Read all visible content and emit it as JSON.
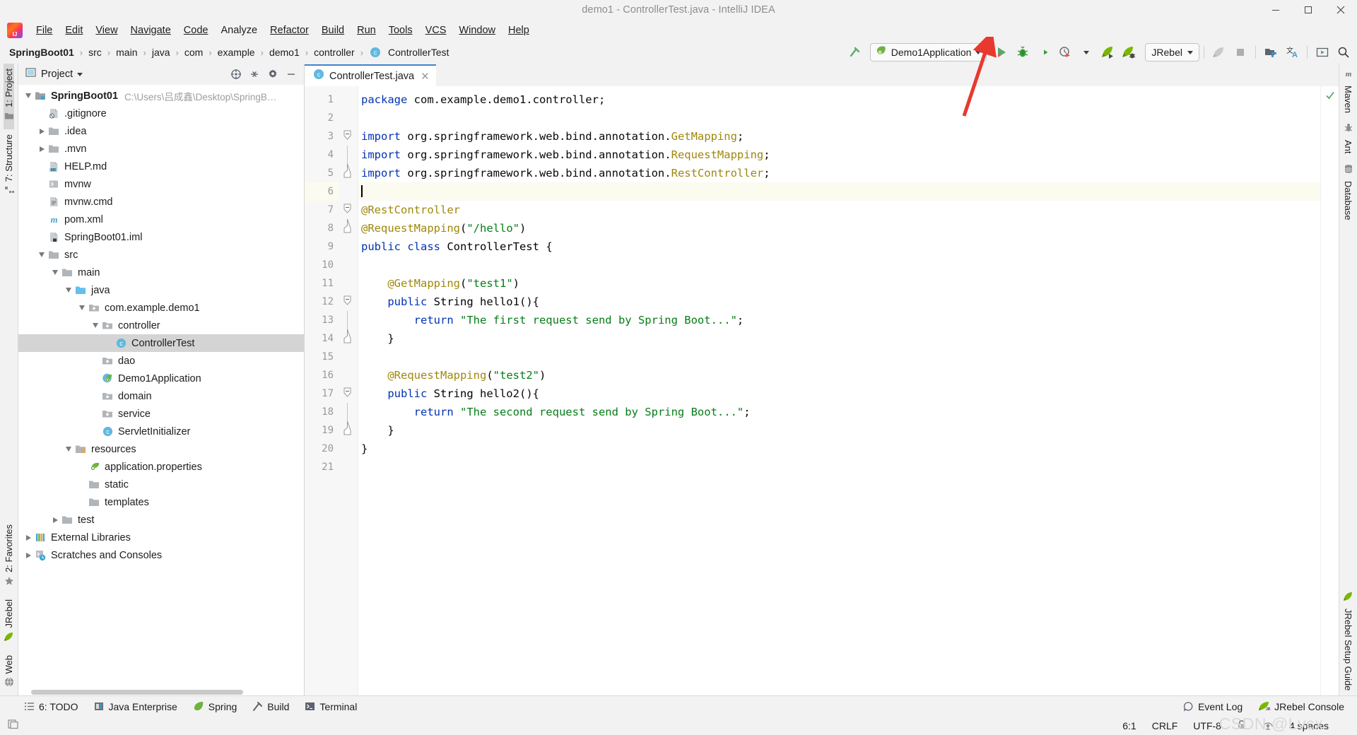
{
  "window": {
    "title": "demo1 - ControllerTest.java - IntelliJ IDEA",
    "minimize": "—",
    "maximize": "❐",
    "close": "✕"
  },
  "menubar": {
    "items": [
      "File",
      "Edit",
      "View",
      "Navigate",
      "Code",
      "Analyze",
      "Refactor",
      "Build",
      "Run",
      "Tools",
      "VCS",
      "Window",
      "Help"
    ]
  },
  "breadcrumb": {
    "items": [
      "SpringBoot01",
      "src",
      "main",
      "java",
      "com",
      "example",
      "demo1",
      "controller",
      "ControllerTest"
    ],
    "separator": "›"
  },
  "run_toolbar": {
    "config_name": "Demo1Application",
    "config_icon": "spring-boot-icon",
    "dropdown_caret": "▾",
    "buttons": [
      {
        "name": "run-button",
        "icon": "play-icon",
        "color": "#59a869"
      },
      {
        "name": "debug-button",
        "icon": "bug-icon",
        "color": "#3b9d3b"
      },
      {
        "name": "run-with-coverage-button",
        "icon": "coverage-icon",
        "color": "#4a4a4a"
      },
      {
        "name": "profiler-button",
        "icon": "profiler-icon",
        "color": "#6e6e6e"
      },
      {
        "name": "jrebel-run-button",
        "icon": "jrebel-rocket-icon",
        "color": "#7ab800"
      },
      {
        "name": "jrebel-debug-button",
        "icon": "jrebel-debug-icon",
        "color": "#7ab800"
      }
    ],
    "jrebel_label": "JRebel",
    "right_buttons": [
      {
        "name": "jrebel-stop-icon",
        "label": ""
      },
      {
        "name": "stop-button",
        "label": ""
      },
      {
        "name": "project-structure-icon",
        "label": ""
      },
      {
        "name": "translate-icon",
        "label": ""
      },
      {
        "name": "presentation-icon",
        "label": ""
      },
      {
        "name": "search-everywhere-icon",
        "label": ""
      }
    ],
    "update_icon": "hammer-icon"
  },
  "left_stripe": {
    "top": [
      {
        "label": "1: Project",
        "icon": "project-folder-icon",
        "active": true
      },
      {
        "label": "7: Structure",
        "icon": "structure-icon",
        "active": false
      }
    ],
    "bottom": [
      {
        "label": "2: Favorites",
        "icon": "star-icon",
        "active": false
      },
      {
        "label": "JRebel",
        "icon": "jrebel-rocket-icon",
        "active": false
      },
      {
        "label": "Web",
        "icon": "web-globe-icon",
        "active": false
      }
    ]
  },
  "right_stripe": {
    "top": [
      {
        "label": "Maven",
        "icon": "maven-m-icon"
      },
      {
        "label": "Ant",
        "icon": "ant-icon"
      },
      {
        "label": "Database",
        "icon": "database-icon"
      }
    ],
    "bottom": [
      {
        "label": "JRebel Setup Guide",
        "icon": "jrebel-rocket-icon"
      }
    ]
  },
  "project_panel": {
    "title": "Project",
    "title_caret": "▾",
    "actions": [
      {
        "name": "select-opened-file-icon"
      },
      {
        "name": "collapse-all-icon"
      },
      {
        "name": "settings-gear-icon"
      },
      {
        "name": "hide-panel-icon"
      }
    ],
    "tree": [
      {
        "depth": 0,
        "twist": "open",
        "icon": "module-folder-icon",
        "label": "SpringBoot01",
        "bold": true,
        "path": "C:\\Users\\吕成鑫\\Desktop\\SpringB…",
        "selected": false
      },
      {
        "depth": 1,
        "twist": "none",
        "icon": "gitignore-file-icon",
        "label": ".gitignore",
        "bold": false,
        "path": "",
        "selected": false
      },
      {
        "depth": 1,
        "twist": "closed",
        "icon": "folder-icon",
        "label": ".idea",
        "bold": false,
        "path": "",
        "selected": false
      },
      {
        "depth": 1,
        "twist": "closed",
        "icon": "folder-icon",
        "label": ".mvn",
        "bold": false,
        "path": "",
        "selected": false
      },
      {
        "depth": 1,
        "twist": "none",
        "icon": "markdown-file-icon",
        "label": "HELP.md",
        "bold": false,
        "path": "",
        "selected": false
      },
      {
        "depth": 1,
        "twist": "none",
        "icon": "shell-script-icon",
        "label": "mvnw",
        "bold": false,
        "path": "",
        "selected": false
      },
      {
        "depth": 1,
        "twist": "none",
        "icon": "cmd-file-icon",
        "label": "mvnw.cmd",
        "bold": false,
        "path": "",
        "selected": false
      },
      {
        "depth": 1,
        "twist": "none",
        "icon": "maven-pom-icon",
        "label": "pom.xml",
        "bold": false,
        "path": "",
        "selected": false
      },
      {
        "depth": 1,
        "twist": "none",
        "icon": "iml-file-icon",
        "label": "SpringBoot01.iml",
        "bold": false,
        "path": "",
        "selected": false
      },
      {
        "depth": 1,
        "twist": "open",
        "icon": "folder-icon",
        "label": "src",
        "bold": false,
        "path": "",
        "selected": false
      },
      {
        "depth": 2,
        "twist": "open",
        "icon": "folder-icon",
        "label": "main",
        "bold": false,
        "path": "",
        "selected": false
      },
      {
        "depth": 3,
        "twist": "open",
        "icon": "source-folder-icon",
        "label": "java",
        "bold": false,
        "path": "",
        "selected": false
      },
      {
        "depth": 4,
        "twist": "open",
        "icon": "package-icon",
        "label": "com.example.demo1",
        "bold": false,
        "path": "",
        "selected": false
      },
      {
        "depth": 5,
        "twist": "open",
        "icon": "package-icon",
        "label": "controller",
        "bold": false,
        "path": "",
        "selected": false
      },
      {
        "depth": 6,
        "twist": "none",
        "icon": "java-class-icon",
        "label": "ControllerTest",
        "bold": false,
        "path": "",
        "selected": true
      },
      {
        "depth": 5,
        "twist": "none",
        "icon": "package-icon",
        "label": "dao",
        "bold": false,
        "path": "",
        "selected": false
      },
      {
        "depth": 5,
        "twist": "none",
        "icon": "spring-boot-class-icon",
        "label": "Demo1Application",
        "bold": false,
        "path": "",
        "selected": false
      },
      {
        "depth": 5,
        "twist": "none",
        "icon": "package-icon",
        "label": "domain",
        "bold": false,
        "path": "",
        "selected": false
      },
      {
        "depth": 5,
        "twist": "none",
        "icon": "package-icon",
        "label": "service",
        "bold": false,
        "path": "",
        "selected": false
      },
      {
        "depth": 5,
        "twist": "none",
        "icon": "java-class-icon",
        "label": "ServletInitializer",
        "bold": false,
        "path": "",
        "selected": false
      },
      {
        "depth": 3,
        "twist": "open",
        "icon": "resource-folder-icon",
        "label": "resources",
        "bold": false,
        "path": "",
        "selected": false
      },
      {
        "depth": 4,
        "twist": "none",
        "icon": "spring-properties-icon",
        "label": "application.properties",
        "bold": false,
        "path": "",
        "selected": false
      },
      {
        "depth": 4,
        "twist": "none",
        "icon": "folder-icon",
        "label": "static",
        "bold": false,
        "path": "",
        "selected": false
      },
      {
        "depth": 4,
        "twist": "none",
        "icon": "folder-icon",
        "label": "templates",
        "bold": false,
        "path": "",
        "selected": false
      },
      {
        "depth": 2,
        "twist": "closed",
        "icon": "folder-icon",
        "label": "test",
        "bold": false,
        "path": "",
        "selected": false
      },
      {
        "depth": 0,
        "twist": "closed",
        "icon": "libraries-icon",
        "label": "External Libraries",
        "bold": false,
        "path": "",
        "selected": false
      },
      {
        "depth": 0,
        "twist": "closed",
        "icon": "scratches-icon",
        "label": "Scratches and Consoles",
        "bold": false,
        "path": "",
        "selected": false
      }
    ]
  },
  "editor": {
    "tab": {
      "label": "ControllerTest.java",
      "icon": "java-class-icon",
      "close": "✕"
    },
    "cursor_line": 6,
    "lines": [
      {
        "n": 1,
        "fold": "none",
        "gutter_mark": "none",
        "tokens": [
          {
            "t": "package ",
            "c": "kw"
          },
          {
            "t": "com.example.demo1.controller;",
            "c": "plain"
          }
        ]
      },
      {
        "n": 2,
        "fold": "none",
        "gutter_mark": "none",
        "tokens": []
      },
      {
        "n": 3,
        "fold": "start",
        "gutter_mark": "none",
        "tokens": [
          {
            "t": "import ",
            "c": "kw"
          },
          {
            "t": "org.springframework.web.bind.annotation.",
            "c": "plain"
          },
          {
            "t": "GetMapping",
            "c": "ann"
          },
          {
            "t": ";",
            "c": "plain"
          }
        ]
      },
      {
        "n": 4,
        "fold": "mid",
        "gutter_mark": "none",
        "tokens": [
          {
            "t": "import ",
            "c": "kw"
          },
          {
            "t": "org.springframework.web.bind.annotation.",
            "c": "plain"
          },
          {
            "t": "RequestMapping",
            "c": "ann"
          },
          {
            "t": ";",
            "c": "plain"
          }
        ]
      },
      {
        "n": 5,
        "fold": "end",
        "gutter_mark": "none",
        "tokens": [
          {
            "t": "import ",
            "c": "kw"
          },
          {
            "t": "org.springframework.web.bind.annotation.",
            "c": "plain"
          },
          {
            "t": "RestController",
            "c": "ann"
          },
          {
            "t": ";",
            "c": "plain"
          }
        ]
      },
      {
        "n": 6,
        "fold": "none",
        "gutter_mark": "none",
        "caret": true,
        "tokens": []
      },
      {
        "n": 7,
        "fold": "start",
        "gutter_mark": "none",
        "tokens": [
          {
            "t": "@RestController",
            "c": "ann"
          }
        ]
      },
      {
        "n": 8,
        "fold": "end",
        "gutter_mark": "none",
        "tokens": [
          {
            "t": "@RequestMapping",
            "c": "ann"
          },
          {
            "t": "(",
            "c": "plain"
          },
          {
            "t": "\"/hello\"",
            "c": "str"
          },
          {
            "t": ")",
            "c": "plain"
          }
        ]
      },
      {
        "n": 9,
        "fold": "none",
        "gutter_mark": "spring-bean",
        "tokens": [
          {
            "t": "public ",
            "c": "kw"
          },
          {
            "t": "class ",
            "c": "kw"
          },
          {
            "t": "ControllerTest ",
            "c": "cls"
          },
          {
            "t": "{",
            "c": "plain"
          }
        ]
      },
      {
        "n": 10,
        "fold": "none",
        "gutter_mark": "none",
        "tokens": []
      },
      {
        "n": 11,
        "fold": "none",
        "gutter_mark": "none",
        "tokens": [
          {
            "t": "    ",
            "c": "plain"
          },
          {
            "t": "@GetMapping",
            "c": "ann"
          },
          {
            "t": "(",
            "c": "plain"
          },
          {
            "t": "\"test1\"",
            "c": "str"
          },
          {
            "t": ")",
            "c": "plain"
          }
        ]
      },
      {
        "n": 12,
        "fold": "start",
        "gutter_mark": "spring-bean",
        "tokens": [
          {
            "t": "    ",
            "c": "plain"
          },
          {
            "t": "public ",
            "c": "kw"
          },
          {
            "t": "String ",
            "c": "cls"
          },
          {
            "t": "hello1",
            "c": "plain"
          },
          {
            "t": "(){",
            "c": "plain"
          }
        ]
      },
      {
        "n": 13,
        "fold": "mid",
        "gutter_mark": "none",
        "tokens": [
          {
            "t": "        ",
            "c": "plain"
          },
          {
            "t": "return ",
            "c": "kw"
          },
          {
            "t": "\"The first request send by Spring Boot...\"",
            "c": "str"
          },
          {
            "t": ";",
            "c": "plain"
          }
        ]
      },
      {
        "n": 14,
        "fold": "end",
        "gutter_mark": "none",
        "tokens": [
          {
            "t": "    }",
            "c": "plain"
          }
        ]
      },
      {
        "n": 15,
        "fold": "none",
        "gutter_mark": "none",
        "tokens": []
      },
      {
        "n": 16,
        "fold": "none",
        "gutter_mark": "none",
        "tokens": [
          {
            "t": "    ",
            "c": "plain"
          },
          {
            "t": "@RequestMapping",
            "c": "ann"
          },
          {
            "t": "(",
            "c": "plain"
          },
          {
            "t": "\"test2\"",
            "c": "str"
          },
          {
            "t": ")",
            "c": "plain"
          }
        ]
      },
      {
        "n": 17,
        "fold": "start",
        "gutter_mark": "spring-bean",
        "tokens": [
          {
            "t": "    ",
            "c": "plain"
          },
          {
            "t": "public ",
            "c": "kw"
          },
          {
            "t": "String ",
            "c": "cls"
          },
          {
            "t": "hello2",
            "c": "plain"
          },
          {
            "t": "(){",
            "c": "plain"
          }
        ]
      },
      {
        "n": 18,
        "fold": "mid",
        "gutter_mark": "none",
        "tokens": [
          {
            "t": "        ",
            "c": "plain"
          },
          {
            "t": "return ",
            "c": "kw"
          },
          {
            "t": "\"The second request send by Spring Boot...\"",
            "c": "str"
          },
          {
            "t": ";",
            "c": "plain"
          }
        ]
      },
      {
        "n": 19,
        "fold": "end",
        "gutter_mark": "none",
        "tokens": [
          {
            "t": "    }",
            "c": "plain"
          }
        ]
      },
      {
        "n": 20,
        "fold": "none",
        "gutter_mark": "none",
        "tokens": [
          {
            "t": "}",
            "c": "plain"
          }
        ]
      },
      {
        "n": 21,
        "fold": "none",
        "gutter_mark": "none",
        "tokens": []
      }
    ],
    "inspection_status": "ok-check"
  },
  "tool_window_bar": {
    "items": [
      {
        "label": "6: TODO",
        "underline": "6",
        "icon": "todo-list-icon"
      },
      {
        "label": "Java Enterprise",
        "underline": "",
        "icon": "java-enterprise-icon"
      },
      {
        "label": "Spring",
        "underline": "",
        "icon": "spring-leaf-icon"
      },
      {
        "label": "Build",
        "underline": "",
        "icon": "hammer-icon"
      },
      {
        "label": "Terminal",
        "underline": "",
        "icon": "terminal-icon"
      }
    ],
    "right_items": [
      {
        "label": "Event Log",
        "icon": "event-log-icon"
      },
      {
        "label": "JRebel Console",
        "icon": "jrebel-rocket-icon"
      }
    ]
  },
  "status_bar": {
    "left_icon": "memory-indicator-icon",
    "position": "6:1",
    "line_separator": "CRLF",
    "encoding": "UTF-8",
    "lock_icon": "unlocked-icon",
    "inspection_icon": "inspection-eye-icon",
    "indent": "4 spaces"
  },
  "watermark": "CSDN @Lvcx",
  "colors": {
    "accent_blue": "#4083c9",
    "keyword": "#0033b3",
    "string": "#067d17",
    "annotation": "#9e880d",
    "selection": "#d4d4d4",
    "caret_row": "#fcfbef",
    "arrow_red": "#e8392e"
  }
}
